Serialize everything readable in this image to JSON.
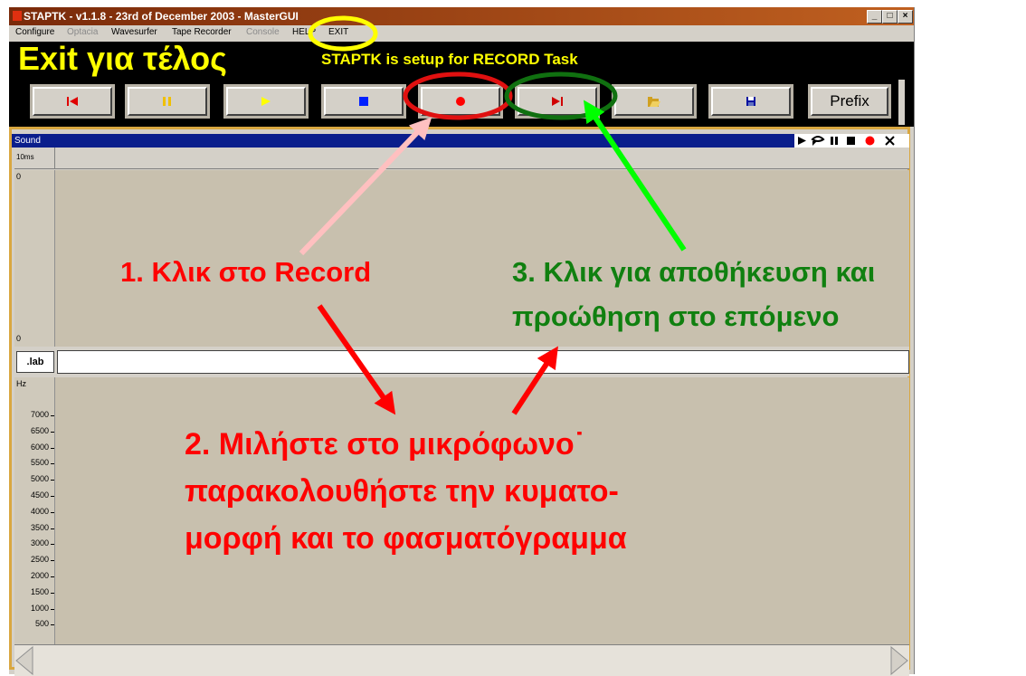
{
  "window": {
    "title": "STAPTK - v1.1.8 - 23rd of December 2003 - MasterGUI",
    "controls": [
      "_",
      "□",
      "×"
    ]
  },
  "menu": {
    "items": [
      {
        "label": "Configure",
        "enabled": true
      },
      {
        "label": "Optacia",
        "enabled": false
      },
      {
        "label": "Wavesurfer",
        "enabled": true
      },
      {
        "label": "Tape Recorder",
        "enabled": true
      },
      {
        "label": "Console",
        "enabled": false
      },
      {
        "label": "HELP",
        "enabled": true
      },
      {
        "label": "EXIT",
        "enabled": true
      }
    ]
  },
  "banner": {
    "big_text": "Exit για τέλος",
    "status": "STAPTK is setup for RECORD Task",
    "text_color": "#ffff00"
  },
  "toolbar": {
    "buttons": [
      {
        "icon": "skip-back-icon",
        "color": "#e00000"
      },
      {
        "icon": "pause-icon",
        "color": "#f0c000"
      },
      {
        "icon": "play-icon",
        "color": "#ffff00"
      },
      {
        "icon": "stop-icon",
        "color": "#0020ff"
      },
      {
        "icon": "record-icon",
        "color": "#ff0000"
      },
      {
        "icon": "skip-forward-icon",
        "color": "#d00000"
      },
      {
        "icon": "open-folder-icon",
        "color": "#d0a020"
      },
      {
        "icon": "save-icon",
        "color": "#0010a0"
      },
      {
        "label": "Prefix"
      }
    ]
  },
  "sound_panel": {
    "title": "Sound",
    "controls": [
      "play-icon",
      "loop-icon",
      "pause-icon",
      "stop-icon",
      "record-icon",
      "close-icon"
    ],
    "scale_label": "10ms",
    "wave_top": "0",
    "wave_bottom": "0",
    "lab_label": ".lab"
  },
  "spectrogram": {
    "unit": "Hz",
    "ticks": [
      "7000",
      "6500",
      "6000",
      "5500",
      "5000",
      "4500",
      "4000",
      "3500",
      "3000",
      "2500",
      "2000",
      "1500",
      "1000",
      "500"
    ]
  },
  "annotations": {
    "step1": "1. Κλικ στο Record",
    "step2_lines": [
      "2. Μιλήστε στο μικρόφωνο˙",
      "παρακολουθήστε  την  κυματο-",
      "μορφή και το φασματόγραμμα"
    ],
    "step3_lines": [
      "3. Κλικ για αποθήκευση και",
      "προώθηση στο επόμενο"
    ],
    "colors": {
      "red": "#ff0000",
      "green": "#108010",
      "pink": "#ffc0c0",
      "bright_green": "#00ff00",
      "yellow": "#ffff00"
    }
  }
}
